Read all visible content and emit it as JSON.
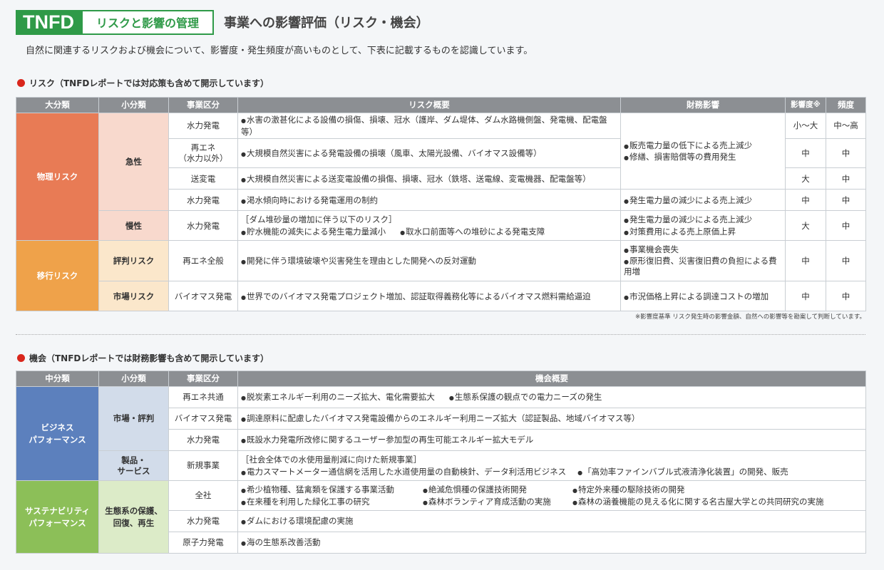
{
  "header": {
    "badge": "TNFD",
    "category": "リスクと影響の管理",
    "title": "事業への影響評価（リスク・機会）"
  },
  "intro": "自然に関連するリスクおよび機会について、影響度・発生頻度が高いものとして、下表に記載するものを認識しています。",
  "risk": {
    "heading": "リスク（TNFDレポートでは対応策も含めて開示しています）",
    "columns": [
      "大分類",
      "小分類",
      "事業区分",
      "リスク概要",
      "財務影響",
      "影響度※",
      "頻度"
    ],
    "physical": "物理リスク",
    "acute": "急性",
    "chronic": "慢性",
    "transition": "移行リスク",
    "reputation": "評判リスク",
    "market": "市場リスク",
    "rows": [
      {
        "segment": "水力発電",
        "summary": "水害の激甚化による設備の損傷、損壊、冠水（護岸、ダム堤体、ダム水路機側盤、発電機、配電盤等）",
        "impact": "小〜大",
        "freq": "中〜高"
      },
      {
        "segment": "再エネ\n（水力以外）",
        "summary": "大規模自然災害による発電設備の損壊（風車、太陽光設備、バイオマス設備等）",
        "impact": "中",
        "freq": "中"
      },
      {
        "segment": "送変電",
        "summary": "大規模自然災害による送変電設備の損傷、損壊、冠水（鉄塔、送電線、変電機器、配電盤等）",
        "impact": "大",
        "freq": "中"
      },
      {
        "segment": "水力発電",
        "summary": "渇水傾向時における発電運用の制約",
        "finance": "発生電力量の減少による売上減少",
        "impact": "中",
        "freq": "中"
      },
      {
        "segment": "水力発電",
        "summary_head": "［ダム堆砂量の増加に伴う以下のリスク］",
        "summary_a": "貯水機能の減失による発生電力量減小",
        "summary_b": "取水口前面等への堆砂による発電支障",
        "finance_a": "発生電力量の減少による売上減少",
        "finance_b": "対策費用による売上原価上昇",
        "impact": "大",
        "freq": "中"
      },
      {
        "segment": "再エネ全般",
        "summary": "開発に伴う環境破壊や災害発生を理由とした開発への反対運動",
        "finance_a": "事業機会喪失",
        "finance_b": "原形復旧費、災害復旧費の負担による費用増",
        "impact": "中",
        "freq": "中"
      },
      {
        "segment": "バイオマス発電",
        "summary": "世界でのバイオマス発電プロジェクト増加、認証取得義務化等によるバイオマス燃料需給逼迫",
        "finance": "市況価格上昇による調達コストの増加",
        "impact": "中",
        "freq": "中"
      }
    ],
    "finance_acute_a": "販売電力量の低下による売上減少",
    "finance_acute_b": "修繕、損害賠償等の費用発生",
    "note": "※影響度基準 リスク発生時の影響金額、自然への影響等を勘案して判断しています。"
  },
  "opp": {
    "heading": "機会（TNFDレポートでは財務影響も含めて開示しています）",
    "columns": [
      "中分類",
      "小分類",
      "事業区分",
      "機会概要"
    ],
    "business": "ビジネス\nパフォーマンス",
    "market": "市場・評判",
    "product": "製品・\nサービス",
    "sustain": "サステナビリティ\nパフォーマンス",
    "eco": "生態系の保護、\n回復、再生",
    "r1": {
      "segment": "再エネ共通",
      "a": "脱炭素エネルギー利用のニーズ拡大、電化需要拡大",
      "b": "生態系保護の観点での電力ニーズの発生"
    },
    "r2": {
      "segment": "バイオマス発電",
      "a": "調達原料に配慮したバイオマス発電設備からのエネルギー利用ニーズ拡大（認証製品、地域バイオマス等）"
    },
    "r3": {
      "segment": "水力発電",
      "a": "既設水力発電所改修に関するユーザー参加型の再生可能エネルギー拡大モデル"
    },
    "r4": {
      "segment": "新規事業",
      "head": "［社会全体での水使用量削減に向けた新規事業］",
      "a": "電力スマートメーター通信網を活用した水道使用量の自動検針、データ利活用ビジネス",
      "b": "「高効率ファインバブル式液清浄化装置」の開発、販売"
    },
    "r5": {
      "segment": "全社",
      "a": "希少植物種、猛禽類を保護する事業活動",
      "b": "絶滅危惧種の保護技術開発",
      "c": "特定外来種の駆除技術の開発",
      "d": "在来種を利用した緑化工事の研究",
      "e": "森林ボランティア育成活動の実施",
      "f": "森林の涵養機能の見える化に関する名古屋大学との共同研究の実施"
    },
    "r6": {
      "segment": "水力発電",
      "a": "ダムにおける環境配慮の実施"
    },
    "r7": {
      "segment": "原子力発電",
      "a": "海の生態系改善活動"
    }
  }
}
